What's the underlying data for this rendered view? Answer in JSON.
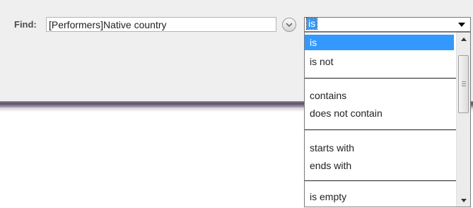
{
  "find": {
    "label": "Find:",
    "field_value": "[Performers]Native country"
  },
  "operator": {
    "selected": "is",
    "options": [
      {
        "label": "is",
        "selected": true
      },
      {
        "label": "is not"
      },
      {
        "label": "contains"
      },
      {
        "label": "does not contain"
      },
      {
        "label": "starts with"
      },
      {
        "label": "ends with"
      },
      {
        "label": "is empty"
      }
    ]
  },
  "colors": {
    "highlight": "#3399ff",
    "panel": "#efefef"
  },
  "icons": {
    "field_menu": "chevron-down-circle-icon",
    "select_arrow": "triangle-down-icon",
    "scroll_up": "triangle-up-icon",
    "scroll_down": "triangle-down-icon"
  }
}
